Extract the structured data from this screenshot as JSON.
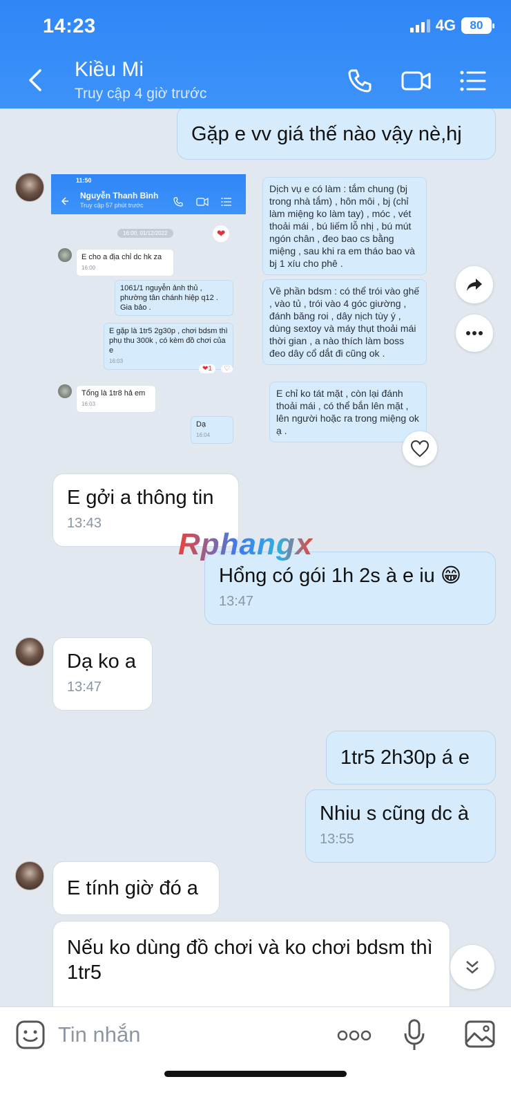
{
  "status_bar": {
    "time": "14:23",
    "network": "4G",
    "battery": "80"
  },
  "header": {
    "title": "Kiều Mi",
    "subtitle": "Truy cập 4 giờ trước",
    "icons": [
      "back-arrow-icon",
      "phone-icon",
      "video-call-icon",
      "menu-list-icon"
    ]
  },
  "messages": [
    {
      "dir": "out",
      "text": "Gặp e vv giá thế nào vậy nè,hj"
    },
    {
      "dir": "in",
      "text": "E gởi a thông tin",
      "time": "13:43"
    },
    {
      "dir": "out",
      "text": "Hổng có gói 1h 2s à e iu 😁",
      "time": "13:47"
    },
    {
      "dir": "in",
      "text": "Dạ ko a",
      "time": "13:47"
    },
    {
      "dir": "out",
      "text": "1tr5 2h30p á e"
    },
    {
      "dir": "out",
      "text": "Nhiu s cũng dc à",
      "time": "13:55"
    },
    {
      "dir": "in",
      "text": "E tính giờ đó a"
    },
    {
      "dir": "in",
      "text": "Nếu ko dùng đồ chơi và ko chơi bdsm thì 1tr5"
    }
  ],
  "shared_screenshot": {
    "status_time": "11:50",
    "contact_name": "Nguyễn Thanh Bình",
    "contact_status": "Truy cập 57 phút trước",
    "date_chip": "16:00, 01/12/2022",
    "mini_messages": [
      {
        "text": "E cho a địa chỉ dc hk za",
        "time": "16:00"
      },
      {
        "text": "1061/1 nguyễn ảnh thủ , phường tân chánh hiệp q12 . Gia bảo ."
      },
      {
        "text": "E gặp là 1tr5 2g30p , chơi bdsm thì phụ thu 300k , có kèm đồ chơi của e",
        "time": "16:03"
      },
      {
        "text": "Tổng là 1tr8 hả em",
        "time": "16:03"
      },
      {
        "text": "Dạ",
        "time": "16:04"
      }
    ],
    "service_texts": [
      "Dịch vụ e có làm : tắm chung (bj trong nhà tắm) , hôn môi , bj (chỉ làm miệng ko làm tay) , móc , vét thoải mái , bú liếm lỗ nhị , bú mút ngón chân , đeo bao cs bằng miệng , sau khi ra em tháo bao và bj 1 xíu cho phê .",
      "Về phần bdsm : có thể trói vào ghế , vào tủ , trói vào 4 góc giường , đánh băng roi , dây nịch tùy ý , dùng sextoy và máy thụt thoải mái thời gian , a nào thích làm boss đeo dây cổ dắt đi cũng ok .",
      "E chỉ ko tát mặt , còn lại đánh thoải mái , có thể bắn lên mặt , lên người hoặc ra trong miệng ok ạ ."
    ]
  },
  "watermark": "Rphangx",
  "composer": {
    "placeholder": "Tin nhắn"
  },
  "colors": {
    "header": "#2f86f6",
    "outgoing_bubble": "#d6ecfd",
    "incoming_bubble": "#ffffff",
    "background": "#e2e8f0"
  }
}
